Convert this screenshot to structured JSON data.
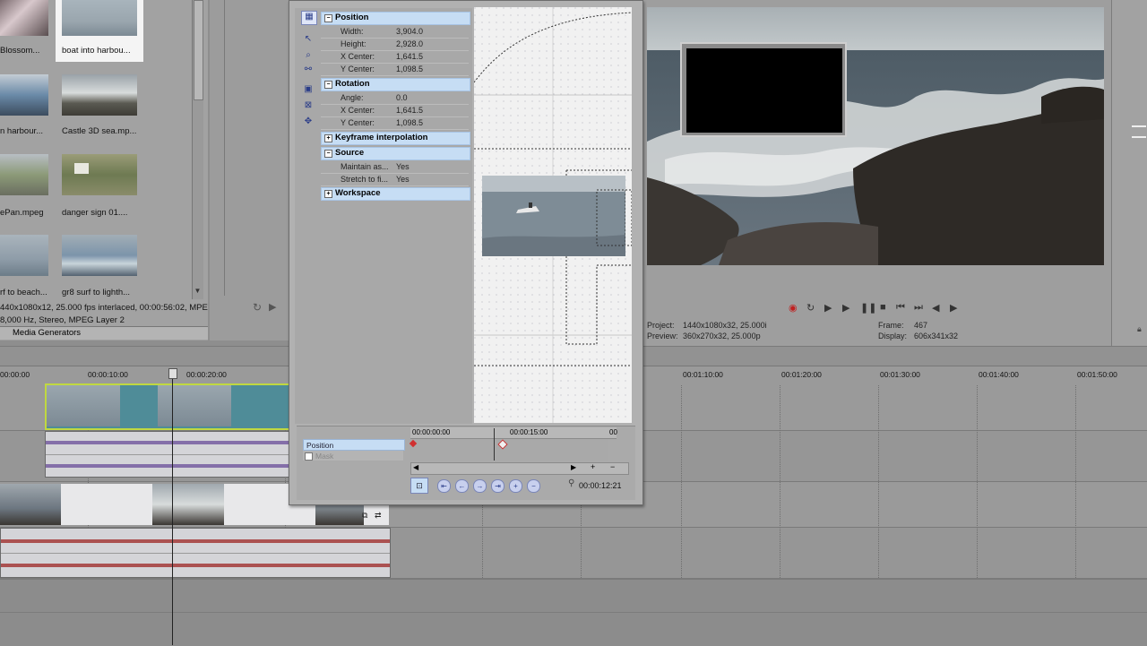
{
  "media": {
    "thumbnails": [
      {
        "label": "Blossom..."
      },
      {
        "label": "boat into harbou..."
      },
      {
        "label": "n harbour..."
      },
      {
        "label": "Castle 3D sea.mp..."
      },
      {
        "label": "ePan.mpeg"
      },
      {
        "label": "danger sign 01...."
      },
      {
        "label": "rf to beach..."
      },
      {
        "label": "gr8 surf to lighth..."
      }
    ],
    "info_line1": "440x1080x12, 25.000 fps interlaced, 00:00:56:02, MPE",
    "info_line2": "8,000 Hz, Stereo, MPEG Layer 2",
    "tab_label": "Media Generators"
  },
  "pan_crop": {
    "sections": {
      "position": {
        "header": "Position",
        "rows": [
          {
            "name": "Width:",
            "value": "3,904.0"
          },
          {
            "name": "Height:",
            "value": "2,928.0"
          },
          {
            "name": "X Center:",
            "value": "1,641.5"
          },
          {
            "name": "Y Center:",
            "value": "1,098.5"
          }
        ]
      },
      "rotation": {
        "header": "Rotation",
        "rows": [
          {
            "name": "Angle:",
            "value": "0.0"
          },
          {
            "name": "X Center:",
            "value": "1,641.5"
          },
          {
            "name": "Y Center:",
            "value": "1,098.5"
          }
        ]
      },
      "keyframe_interpolation": {
        "header": "Keyframe interpolation"
      },
      "source": {
        "header": "Source",
        "rows": [
          {
            "name": "Maintain as...",
            "value": "Yes"
          },
          {
            "name": "Stretch to fi...",
            "value": "Yes"
          }
        ]
      },
      "workspace": {
        "header": "Workspace"
      }
    },
    "timeline": {
      "start_time": "00:00:00:00",
      "mid_time": "00:00:15:00",
      "end_time": "00",
      "tracks": [
        {
          "label": "Position"
        },
        {
          "label": "Mask"
        }
      ],
      "current_time": "00:00:12:21"
    }
  },
  "preview": {
    "project_label": "Project:",
    "project_value": "1440x1080x32, 25.000i",
    "preview_label": "Preview:",
    "preview_value": "360x270x32, 25.000p",
    "frame_label": "Frame:",
    "frame_value": "467",
    "display_label": "Display:",
    "display_value": "606x341x32"
  },
  "timeline": {
    "ruler_labels": [
      "00:00:00",
      "00:00:10:00",
      "00:00:20:00",
      "00:01:10:00",
      "00:01:20:00",
      "00:01:30:00",
      "00:01:40:00",
      "00:01:50:00"
    ]
  },
  "colors": {
    "panel_bg": "#8e8e8e",
    "header_blue": "#c6ddf4",
    "audio_purple": "#6a4e9a",
    "audio_red": "#a03030",
    "selection_green": "#c0d840"
  }
}
